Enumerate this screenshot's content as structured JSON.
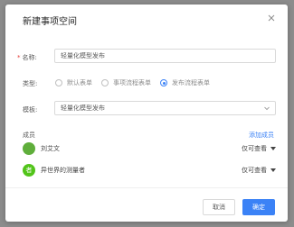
{
  "dialog": {
    "title": "新建事项空间"
  },
  "form": {
    "name_label": "名称:",
    "name_value": "轻量化模型发布",
    "type_label": "类型:",
    "type_options": [
      "默认表单",
      "事项流程表单",
      "发布流程表单"
    ],
    "type_selected": "发布流程表单",
    "template_label": "模板:",
    "template_value": "轻量化模型发布"
  },
  "members": {
    "label": "成员",
    "add_label": "添加成员",
    "items": [
      {
        "name": "刘艾文",
        "permission": "仅可查看",
        "avatar_text": ""
      },
      {
        "name": "异世界的测量者",
        "permission": "仅可查看",
        "avatar_text": "者"
      }
    ]
  },
  "footer": {
    "cancel_label": "取消",
    "ok_label": "确定"
  },
  "colors": {
    "accent": "#3b82f6",
    "required": "#e53935",
    "avatar1": "#5fae3b",
    "avatar2": "#52c41a"
  },
  "icons": [
    "close-icon",
    "chevron-down-icon",
    "caret-down-icon",
    "avatar"
  ]
}
